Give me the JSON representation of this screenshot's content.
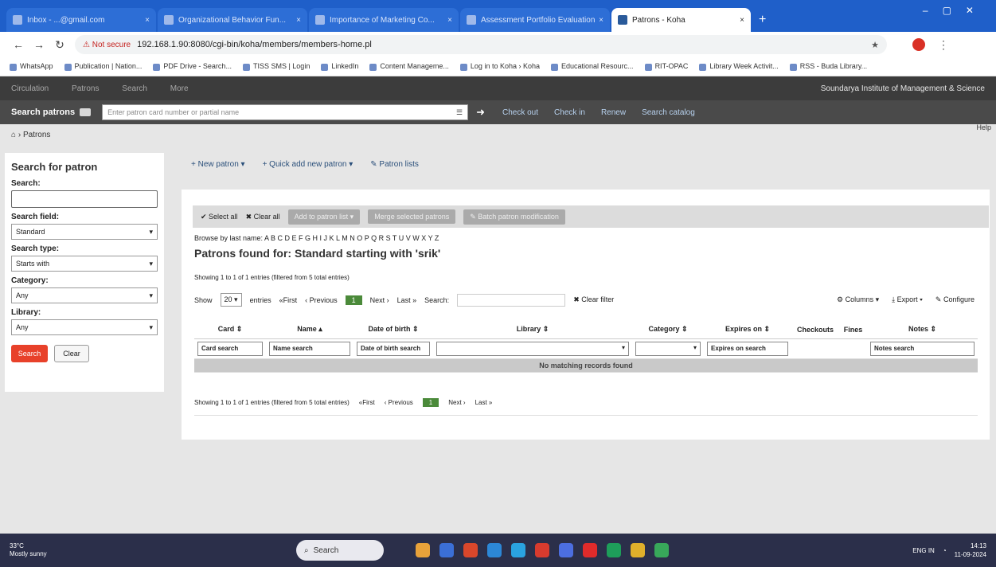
{
  "browser": {
    "tabs": [
      {
        "label": "Inbox - ...@gmail.com",
        "active": false
      },
      {
        "label": "Organizational Behavior Fun...",
        "active": false
      },
      {
        "label": "Importance of Marketing Co...",
        "active": false
      },
      {
        "label": "Assessment Portfolio Evaluation",
        "active": false
      },
      {
        "label": "Patrons - Koha",
        "active": true
      }
    ],
    "url": "192.168.1.90:8080/cgi-bin/koha/members/members-home.pl",
    "not_secure": "Not secure",
    "bookmarks": [
      "WhatsApp",
      "Publication | Nation...",
      "PDF Drive - Search...",
      "TISS SMS | Login",
      "LinkedIn",
      "Content Manageme...",
      "Log in to Koha › Koha",
      "Educational Resourc...",
      "RIT-OPAC",
      "Library Week Activit...",
      "RSS - Buda Library..."
    ]
  },
  "koha": {
    "institution": "Soundarya Institute of Management & Science",
    "nav_menu": [
      "Circulation",
      "Patrons",
      "Search",
      "More"
    ],
    "search_patrons_label": "Search patrons",
    "search_placeholder": "Enter patron card number or partial name",
    "quick_links": [
      "Check out",
      "Check in",
      "Renew",
      "Search catalog"
    ],
    "breadcrumb": "Patrons",
    "help": "Help"
  },
  "sidebar": {
    "title": "Search for patron",
    "search_label": "Search:",
    "search_field_label": "Search field:",
    "search_field_value": "Standard",
    "search_type_label": "Search type:",
    "search_type_value": "Starts with",
    "category_label": "Category:",
    "category_value": "Any",
    "library_label": "Library:",
    "library_value": "Any",
    "search_button": "Search",
    "clear_button": "Clear"
  },
  "toolbar": {
    "new_patron": "+ New patron ▾",
    "quick_add": "+ Quick add new patron ▾",
    "patron_lists": "✎ Patron lists"
  },
  "results": {
    "select_all": "✔ Select all",
    "clear_all": "✖ Clear all",
    "add_to_list": "Add to patron list ▾",
    "merge": "Merge selected patrons",
    "batch_mod": "✎ Batch patron modification",
    "browse": "Browse by last name: A B C D E F G H I J K L M N O P Q R S T U V W X Y Z",
    "found_title": "Patrons found for: Standard starting with 'srik'",
    "showing": "Showing 1 to 1 of 1 entries (filtered from 5 total entries)",
    "show_label": "Show",
    "show_value": "20",
    "entries_label": "entries",
    "first": "«First",
    "previous": "‹ Previous",
    "page": "1",
    "next": "Next ›",
    "last": "Last »",
    "search_label": "Search:",
    "clear_filter": "✖ Clear filter",
    "columns": "Columns ▾",
    "export": "Export ▾",
    "configure": "Configure",
    "columns_headers": [
      "Card",
      "Name",
      "Date of birth",
      "Library",
      "Category",
      "Expires on",
      "Checkouts",
      "Fines",
      "Notes"
    ],
    "filters": {
      "card": "Card search",
      "name": "Name search",
      "dob": "Date of birth search",
      "expires": "Expires on search",
      "notes": "Notes search"
    },
    "no_match": "No matching records found"
  },
  "taskbar": {
    "weather_temp": "33°C",
    "weather_desc": "Mostly sunny",
    "search": "Search",
    "lang": "ENG IN",
    "time": "14:13",
    "date": "11-09-2024"
  }
}
